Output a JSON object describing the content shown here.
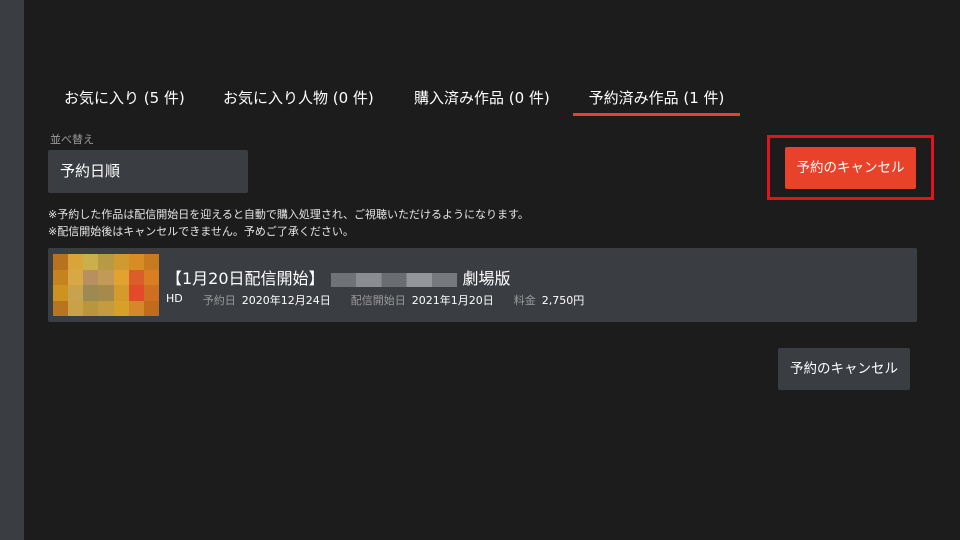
{
  "tabs": [
    {
      "label": "お気に入り (5 件)"
    },
    {
      "label": "お気に入り人物 (0 件)"
    },
    {
      "label": "購入済み作品 (0 件)"
    },
    {
      "label": "予約済み作品 (1 件)"
    }
  ],
  "sort": {
    "label": "並べ替え",
    "value": "予約日順"
  },
  "cancel_button_label": "予約のキャンセル",
  "notes": [
    "※予約した作品は配信開始日を迎えると自動で購入処理され、ご視聴いただけるようになります。",
    "※配信開始後はキャンセルできません。予めご了承ください。"
  ],
  "item": {
    "title_prefix": "【1月20日配信開始】",
    "title_suffix": "劇場版",
    "quality": "HD",
    "reserve_date_label": "予約日",
    "reserve_date": "2020年12月24日",
    "release_date_label": "配信開始日",
    "release_date": "2021年1月20日",
    "price_label": "料金",
    "price": "2,750円"
  },
  "colors": {
    "accent": "#e8432a",
    "highlight": "#e0141e",
    "panel": "#3a3d42",
    "background": "#1c1c1c"
  }
}
